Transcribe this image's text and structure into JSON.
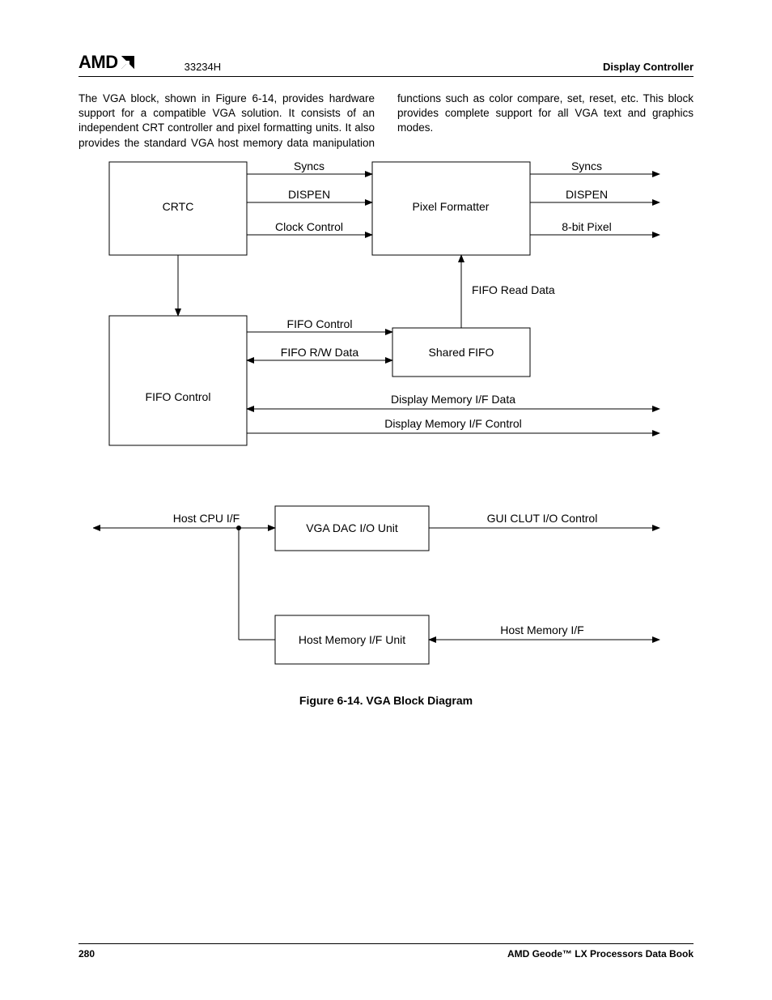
{
  "header": {
    "logo_text": "AMD",
    "doc_number": "33234H",
    "section_title": "Display Controller"
  },
  "body_paragraph": "The VGA block, shown in Figure 6-14, provides hardware support for a compatible VGA solution. It consists of an independent CRT controller and pixel formatting units. It also provides the standard VGA host memory data manipulation functions such as color compare, set, reset, etc. This block provides complete support for all VGA text and graphics modes.",
  "diagram": {
    "blocks": {
      "crtc": "CRTC",
      "pixel_formatter": "Pixel Formatter",
      "fifo_control": "FIFO Control",
      "shared_fifo": "Shared FIFO",
      "vga_dac": "VGA DAC I/O Unit",
      "host_mem_unit": "Host Memory I/F Unit"
    },
    "labels": {
      "syncs1": "Syncs",
      "dispen1": "DISPEN",
      "clock_control": "Clock Control",
      "syncs2": "Syncs",
      "dispen2": "DISPEN",
      "eight_bit_pixel": "8-bit Pixel",
      "fifo_read_data": "FIFO Read Data",
      "fifo_control_sig": "FIFO Control",
      "fifo_rw_data": "FIFO R/W Data",
      "disp_mem_if_data": "Display Memory I/F Data",
      "disp_mem_if_ctrl": "Display Memory I/F Control",
      "host_cpu_if": "Host CPU I/F",
      "gui_clut": "GUI CLUT I/O Control",
      "host_mem_if": "Host Memory I/F"
    }
  },
  "figure_caption": "Figure 6-14.  VGA Block Diagram",
  "footer": {
    "page_number": "280",
    "book_title": "AMD Geode™ LX Processors Data Book"
  }
}
